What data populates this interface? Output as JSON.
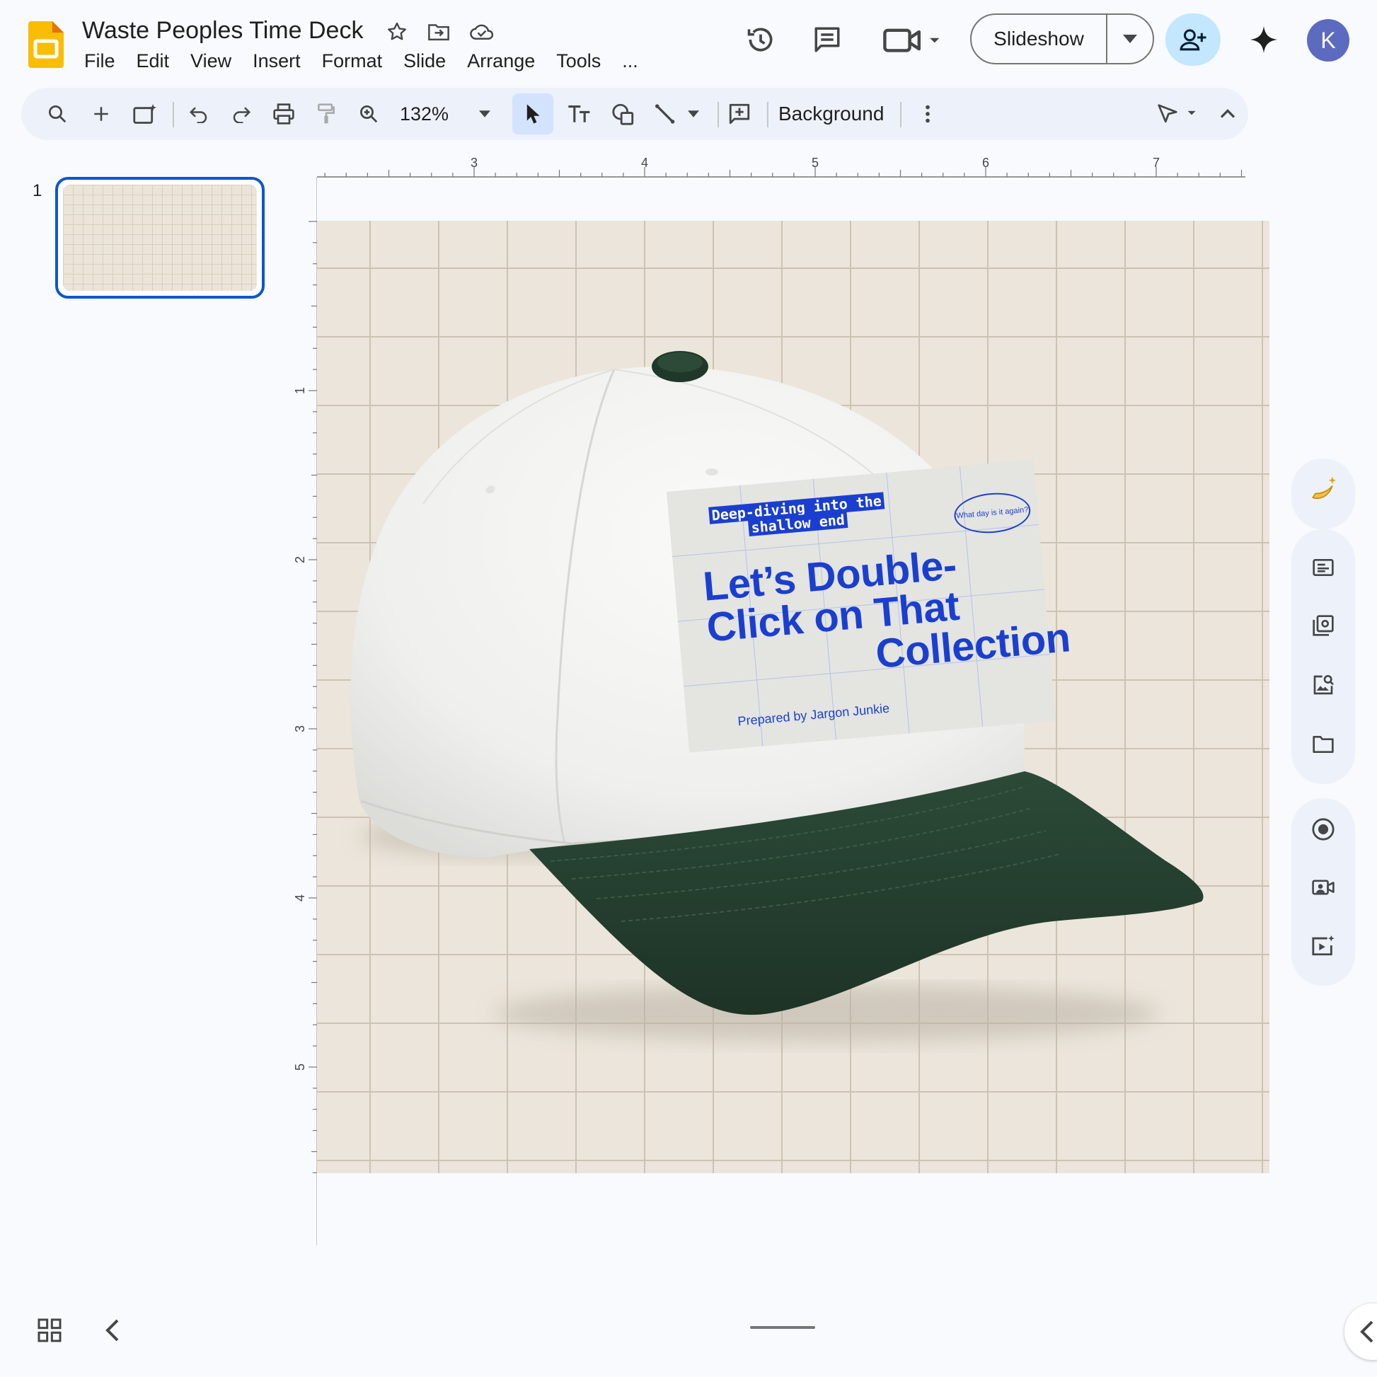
{
  "app": {
    "doc_title": "Waste Peoples Time Deck",
    "menus": [
      "File",
      "Edit",
      "View",
      "Insert",
      "Format",
      "Slide",
      "Arrange",
      "Tools",
      "..."
    ]
  },
  "header": {
    "slideshow_label": "Slideshow",
    "avatar_initial": "K"
  },
  "toolbar": {
    "zoom": "132%",
    "background_label": "Background"
  },
  "filmstrip": {
    "slides": [
      {
        "number": "1"
      }
    ]
  },
  "rulers": {
    "horizontal": [
      "3",
      "4",
      "5",
      "6",
      "7"
    ],
    "vertical": [
      "1",
      "2",
      "3",
      "4",
      "5"
    ]
  },
  "slide": {
    "card_tag": "Deep-diving into the shallow end",
    "card_bubble": "What day is it again?",
    "card_title_line1": "Let’s Double-",
    "card_title_line2": "Click on That",
    "card_title_line3": "Collection",
    "card_author": "Prepared by Jargon Junkie"
  },
  "colors": {
    "accent": "#0b57d0",
    "share_button": "#c2e7ff",
    "card_blue": "#1a3fd0",
    "brim_green": "#243d2e",
    "canvas_bg": "#ebe5db"
  },
  "icons": {
    "side_panel": [
      "banana-sparkle-icon",
      "keep-notes-icon",
      "slides-library-icon",
      "image-search-icon",
      "folder-icon",
      "record-icon",
      "camera-icon",
      "video-sparkle-icon"
    ]
  }
}
